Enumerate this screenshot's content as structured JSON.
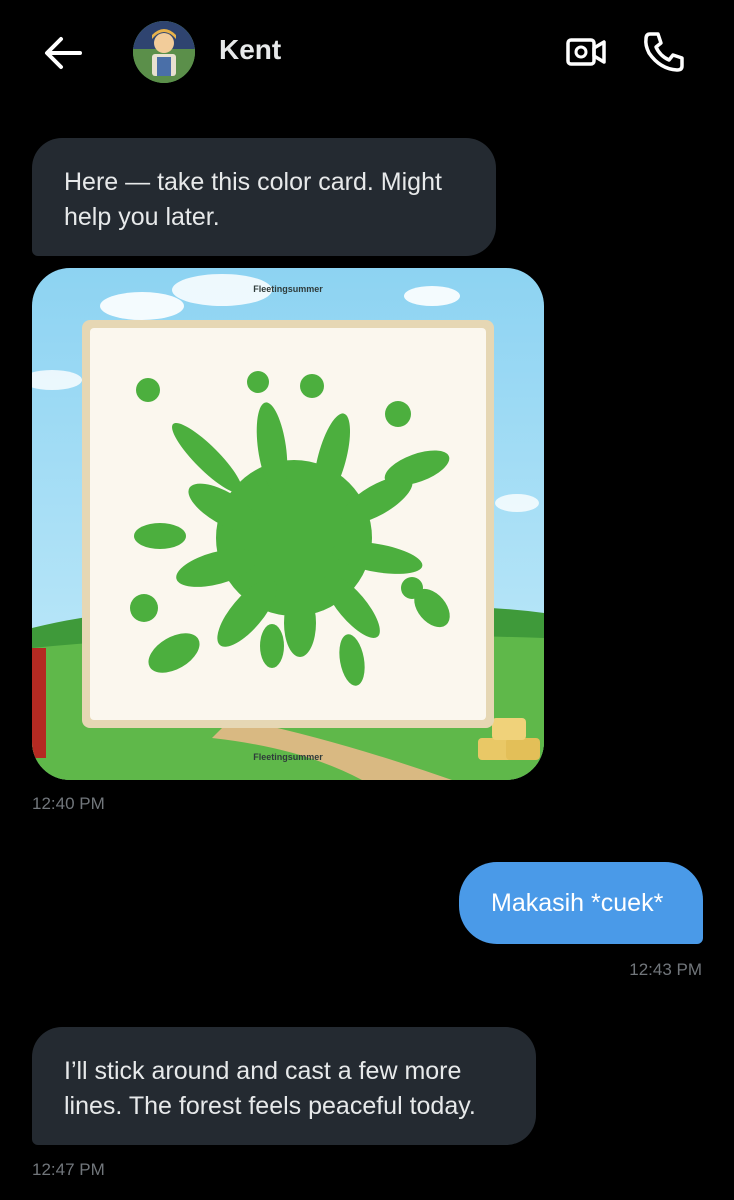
{
  "header": {
    "contact_name": "Kent",
    "back_icon": "arrow-left-icon",
    "video_icon": "video-camera-icon",
    "call_icon": "phone-icon"
  },
  "messages": [
    {
      "direction": "incoming",
      "lines": [
        "Here — take this color card. Might",
        "help you later."
      ],
      "image": {
        "watermark_top": "Fleetingsummer",
        "watermark_bottom": "Fleetingsummer",
        "splat_color": "#4caf3e"
      },
      "time": "12:40 PM"
    },
    {
      "direction": "outgoing",
      "lines": [
        "Makasih *cuek*"
      ],
      "time": "12:43 PM"
    },
    {
      "direction": "incoming",
      "lines": [
        "I’ll stick around and cast a few more",
        "lines. The forest feels peaceful today."
      ],
      "time": "12:47 PM"
    }
  ],
  "colors": {
    "background": "#000000",
    "incoming_bubble": "#242a31",
    "outgoing_bubble": "#4a9ae8",
    "timestamp": "#71767b"
  }
}
